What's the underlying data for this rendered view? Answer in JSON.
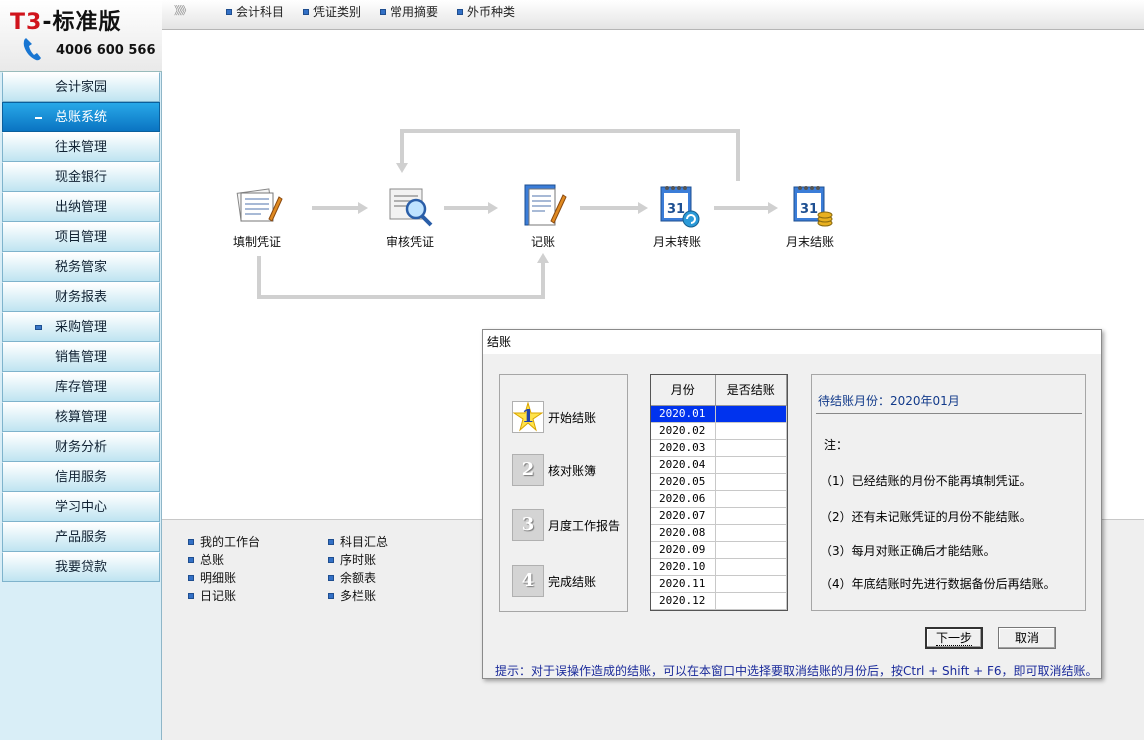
{
  "logo": {
    "title_prefix": "T3",
    "title_suffix": "-标准版",
    "phone": "4006 600 566"
  },
  "sidebar": {
    "items": [
      {
        "label": "会计家园",
        "active": false,
        "bullet": false
      },
      {
        "label": "总账系统",
        "active": true,
        "bullet": true
      },
      {
        "label": "往来管理",
        "active": false,
        "bullet": false
      },
      {
        "label": "现金银行",
        "active": false,
        "bullet": false
      },
      {
        "label": "出纳管理",
        "active": false,
        "bullet": false
      },
      {
        "label": "项目管理",
        "active": false,
        "bullet": false
      },
      {
        "label": "税务管家",
        "active": false,
        "bullet": false
      },
      {
        "label": "财务报表",
        "active": false,
        "bullet": false
      },
      {
        "label": "采购管理",
        "active": false,
        "bullet": true
      },
      {
        "label": "销售管理",
        "active": false,
        "bullet": false
      },
      {
        "label": "库存管理",
        "active": false,
        "bullet": false
      },
      {
        "label": "核算管理",
        "active": false,
        "bullet": false
      },
      {
        "label": "财务分析",
        "active": false,
        "bullet": false
      },
      {
        "label": "信用服务",
        "active": false,
        "bullet": false
      },
      {
        "label": "学习中心",
        "active": false,
        "bullet": false
      },
      {
        "label": "产品服务",
        "active": false,
        "bullet": false
      },
      {
        "label": "我要贷款",
        "active": false,
        "bullet": false
      }
    ]
  },
  "topmenu": {
    "chevron": "》》》",
    "items": [
      "会计科目",
      "凭证类别",
      "常用摘要",
      "外币种类"
    ]
  },
  "flow": {
    "nodes": [
      {
        "label": "填制凭证",
        "icon": "voucher-entry-icon"
      },
      {
        "label": "审核凭证",
        "icon": "voucher-review-icon"
      },
      {
        "label": "记账",
        "icon": "posting-icon"
      },
      {
        "label": "月末转账",
        "icon": "month-end-transfer-icon"
      },
      {
        "label": "月末结账",
        "icon": "month-end-close-icon"
      }
    ]
  },
  "quicklinks": {
    "col1": [
      "我的工作台",
      "总账",
      "明细账",
      "日记账"
    ],
    "col2": [
      "科目汇总",
      "序时账",
      "余额表",
      "多栏账"
    ]
  },
  "dialog": {
    "title": "结账",
    "steps": [
      {
        "num": "1",
        "label": "开始结账",
        "current": true
      },
      {
        "num": "2",
        "label": "核对账簿",
        "current": false
      },
      {
        "num": "3",
        "label": "月度工作报告",
        "current": false
      },
      {
        "num": "4",
        "label": "完成结账",
        "current": false
      }
    ],
    "table": {
      "headers": [
        "月份",
        "是否结账"
      ],
      "rows": [
        {
          "month": "2020.01",
          "closed": "",
          "selected": true
        },
        {
          "month": "2020.02",
          "closed": ""
        },
        {
          "month": "2020.03",
          "closed": ""
        },
        {
          "month": "2020.04",
          "closed": ""
        },
        {
          "month": "2020.05",
          "closed": ""
        },
        {
          "month": "2020.06",
          "closed": ""
        },
        {
          "month": "2020.07",
          "closed": ""
        },
        {
          "month": "2020.08",
          "closed": ""
        },
        {
          "month": "2020.09",
          "closed": ""
        },
        {
          "month": "2020.10",
          "closed": ""
        },
        {
          "month": "2020.11",
          "closed": ""
        },
        {
          "month": "2020.12",
          "closed": ""
        }
      ]
    },
    "info": {
      "pending": "待结账月份：2020年01月",
      "note_title": "注：",
      "notes": [
        "（1）已经结账的月份不能再填制凭证。",
        "（2）还有未记账凭证的月份不能结账。",
        "（3）每月对账正确后才能结账。",
        "（4）年底结账时先进行数据备份后再结账。"
      ]
    },
    "buttons": {
      "next": "下一步",
      "cancel": "取消"
    },
    "hint": "提示：对于误操作造成的结账，可以在本窗口中选择要取消结账的月份后，按Ctrl + Shift + F6，即可取消结账。"
  },
  "colors": {
    "sidebar_active": "#0a74c2",
    "selection": "#0033ee",
    "hint_text": "#1a2a9a"
  }
}
